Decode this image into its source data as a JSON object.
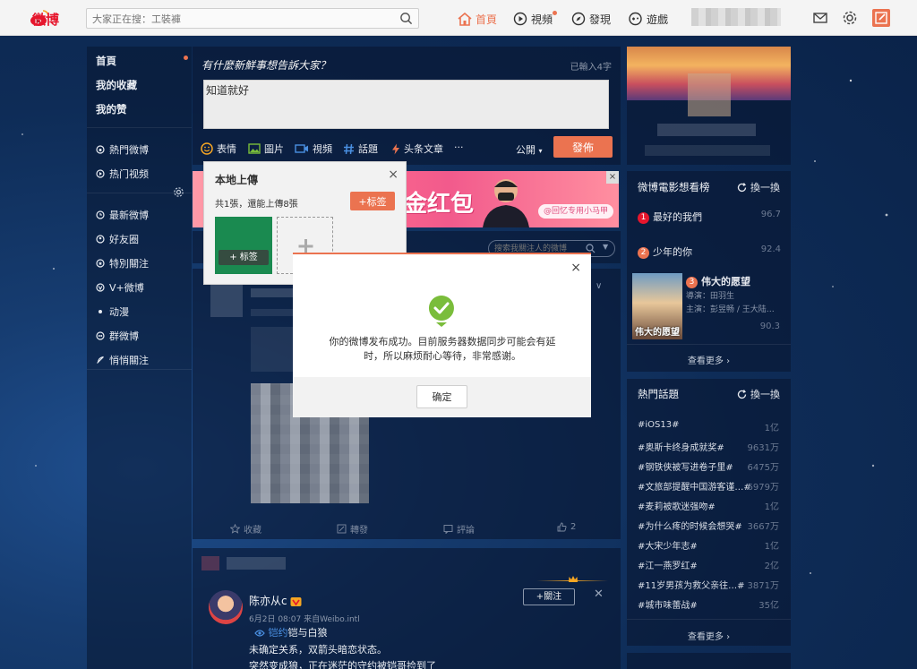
{
  "topbar": {
    "logo_text": "微博",
    "search_placeholder": "大家正在搜：工裝褲",
    "nav": [
      {
        "label": "首頁",
        "icon": "home-icon"
      },
      {
        "label": "視頻",
        "icon": "video-icon"
      },
      {
        "label": "發現",
        "icon": "compass-icon"
      },
      {
        "label": "遊戲",
        "icon": "gamepad-icon"
      }
    ],
    "accent": "#eb7350"
  },
  "leftnav": {
    "items": [
      {
        "label": "首頁"
      },
      {
        "label": "我的收藏"
      },
      {
        "label": "我的赞"
      },
      {
        "label": "熱門微博"
      },
      {
        "label": "热门视频"
      },
      {
        "label": "最新微博"
      },
      {
        "label": "好友圈"
      },
      {
        "label": "特別關注"
      },
      {
        "label": "V+微博"
      },
      {
        "label": "动漫"
      },
      {
        "label": "群微博"
      },
      {
        "label": "悄悄關注"
      }
    ]
  },
  "composer": {
    "title": "有什麼新鮮事想告訴大家？",
    "count_text": "已輸入4字",
    "text": "知道就好",
    "tools": [
      "表情",
      "圖片",
      "視頻",
      "話題",
      "头条文章",
      "···"
    ],
    "visibility": "公開",
    "publish_label": "發佈"
  },
  "upload_popup": {
    "title": "本地上傳",
    "close": "×",
    "info": "共1張，還能上傳8張",
    "tag_button": "+标签",
    "thumb_tag": "+ 标签"
  },
  "banner": {
    "headline": "金红包",
    "pill": "@回忆专用小马甲",
    "close": "×"
  },
  "feed": {
    "search_placeholder": "搜索我關注人的微博",
    "actions": [
      "收藏",
      "轉發",
      "評論",
      "2"
    ],
    "post": {
      "author": "陈亦从c",
      "meta": "6月2日 08:07 来自Weibo.intl",
      "tag": "铠约",
      "tag_rest": "铠与白狼",
      "lines": [
        "未确定关系，双箭头暗恋状态。",
        "突然变成狼，正在迷茫的守约被铠哥捡到了"
      ],
      "follow_label": "+關注"
    }
  },
  "movie_panel": {
    "title": "微博電影想看榜",
    "refresh": "換一換",
    "items": [
      {
        "rank": "1",
        "name": "最好的我們",
        "score": "96.7"
      },
      {
        "rank": "2",
        "name": "少年的你",
        "score": "92.4"
      },
      {
        "rank": "3",
        "name": "伟大的愿望",
        "score": "90.3"
      }
    ],
    "poster_title": "伟大的愿望",
    "director": "導演：田羽生",
    "cast": "主演：彭昱畅 / 王大陆…",
    "more": "查看更多 ›"
  },
  "topics_panel": {
    "title": "熱門話題",
    "refresh": "換一換",
    "items": [
      {
        "name": "#iOS13#",
        "count": "1亿"
      },
      {
        "name": "#奥斯卡终身成就奖#",
        "count": "9631万"
      },
      {
        "name": "#钢铁侠被写进卷子里#",
        "count": "6475万"
      },
      {
        "name": "#文旅部提醒中国游客谨…#",
        "count": "6979万"
      },
      {
        "name": "#麦莉被歌迷强吻#",
        "count": "1亿"
      },
      {
        "name": "#为什么疼的时候会想哭#",
        "count": "3667万"
      },
      {
        "name": "#大宋少年志#",
        "count": "1亿"
      },
      {
        "name": "#江一燕罗红#",
        "count": "2亿"
      },
      {
        "name": "#11岁男孩为救父亲往…#",
        "count": "3871万"
      },
      {
        "name": "#城市味蕾战#",
        "count": "35亿"
      }
    ],
    "more": "查看更多 ›"
  },
  "modal": {
    "close": "×",
    "message": "你的微博发布成功。目前服务器数据同步可能会有延时，所以麻烦耐心等待，非常感谢。",
    "ok_label": "确定",
    "check_color": "#7abd3b"
  }
}
